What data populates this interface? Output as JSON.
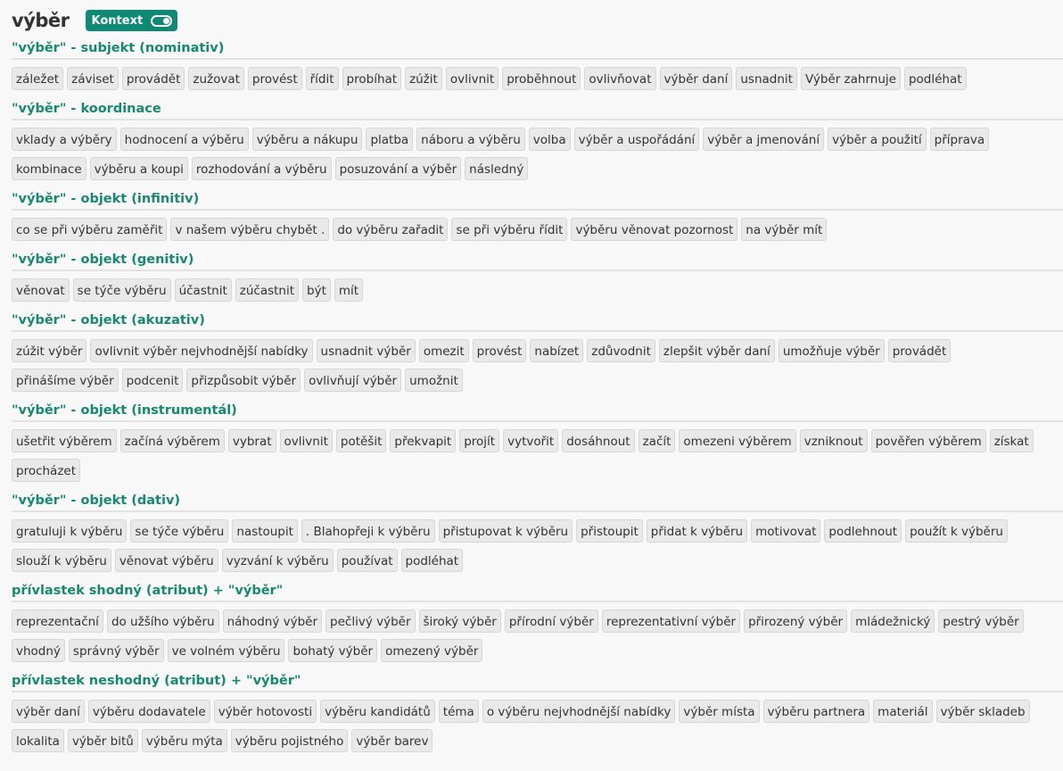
{
  "header": {
    "title": "výběr",
    "toggle_label": "Kontext"
  },
  "sections": [
    {
      "title": "\"výběr\" - subjekt (nominativ)",
      "tags": [
        "záležet",
        "záviset",
        "provádět",
        "zužovat",
        "provést",
        "řídit",
        "probíhat",
        "zúžit",
        "ovlivnit",
        "proběhnout",
        "ovlivňovat",
        "výběr daní",
        "usnadnit",
        "Výběr zahrnuje",
        "podléhat"
      ]
    },
    {
      "title": "\"výběr\" - koordinace",
      "tags": [
        "vklady a výběry",
        "hodnocení a výběru",
        "výběru a nákupu",
        "platba",
        "náboru a výběru",
        "volba",
        "výběr a uspořádání",
        "výběr a jmenování",
        "výběr a použití",
        "příprava",
        "kombinace",
        "výběru a koupi",
        "rozhodování a výběru",
        "posuzování a výběr",
        "následný"
      ]
    },
    {
      "title": "\"výběr\" - objekt (infinitiv)",
      "tags": [
        "co se při výběru zaměřit",
        "v našem výběru chybět .",
        "do výběru zařadit",
        "se při výběru řídit",
        "výběru věnovat pozornost",
        "na výběr mít"
      ]
    },
    {
      "title": "\"výběr\" - objekt (genitiv)",
      "tags": [
        "věnovat",
        "se týče výběru",
        "účastnit",
        "zúčastnit",
        "být",
        "mít"
      ]
    },
    {
      "title": "\"výběr\" - objekt (akuzativ)",
      "tags": [
        "zúžit výběr",
        "ovlivnit výběr nejvhodnější nabídky",
        "usnadnit výběr",
        "omezit",
        "provést",
        "nabízet",
        "zdůvodnit",
        "zlepšit výběr daní",
        "umožňuje výběr",
        "provádět",
        "přinášíme výběr",
        "podcenit",
        "přizpůsobit výběr",
        "ovlivňují výběr",
        "umožnit"
      ]
    },
    {
      "title": "\"výběr\" - objekt (instrumentál)",
      "tags": [
        "ušetřit výběrem",
        "začíná výběrem",
        "vybrat",
        "ovlivnit",
        "potěšit",
        "překvapit",
        "projít",
        "vytvořit",
        "dosáhnout",
        "začít",
        "omezeni výběrem",
        "vzniknout",
        "pověřen výběrem",
        "získat",
        "procházet"
      ]
    },
    {
      "title": "\"výběr\" - objekt (dativ)",
      "tags": [
        "gratuluji k výběru",
        "se týče výběru",
        "nastoupit",
        ". Blahopřeji k výběru",
        "přistupovat k výběru",
        "přistoupit",
        "přidat k výběru",
        "motivovat",
        "podlehnout",
        "použít k výběru",
        "slouží k výběru",
        "věnovat výběru",
        "vyzvání k výběru",
        "používat",
        "podléhat"
      ]
    },
    {
      "title": "přívlastek shodný (atribut) + \"výběr\"",
      "tags": [
        "reprezentační",
        "do užšího výběru",
        "náhodný výběr",
        "pečlivý výběr",
        "široký výběr",
        "přírodní výběr",
        "reprezentativní výběr",
        "přirozený výběr",
        "mládežnický",
        "pestrý výběr",
        "vhodný",
        "správný výběr",
        "ve volném výběru",
        "bohatý výběr",
        "omezený výběr"
      ]
    },
    {
      "title": "přívlastek neshodný (atribut) + \"výběr\"",
      "tags": [
        "výběr daní",
        "výběru dodavatele",
        "výběr hotovosti",
        "výběru kandidátů",
        "téma",
        "o výběru nejvhodnější nabídky",
        "výběr místa",
        "výběru partnera",
        "materiál",
        "výběr skladeb",
        "lokalita",
        "výběr bitů",
        "výběru mýta",
        "výběru pojistného",
        "výběr barev"
      ]
    }
  ]
}
